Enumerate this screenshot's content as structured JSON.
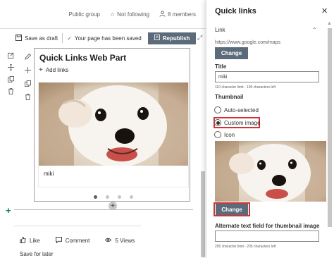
{
  "header": {
    "group_label": "Public group",
    "follow_label": "Not following",
    "members_label": "8 members"
  },
  "cmdbar": {
    "save_draft_label": "Save as draft",
    "saved_status": "Your page has been saved",
    "republish_label": "Republish"
  },
  "webpart": {
    "title": "Quick Links Web Part",
    "add_links_label": "Add links",
    "caption": "miki",
    "carousel_pages": 4,
    "carousel_active": 1
  },
  "social": {
    "like_label": "Like",
    "comment_label": "Comment",
    "views_label": "5 Views",
    "save_later_label": "Save for later"
  },
  "pane": {
    "title": "Quick links",
    "link_section_label": "Link",
    "link_url": "https://www.google.com/maps",
    "change_label": "Change",
    "title_label": "Title",
    "title_value": "miki",
    "title_hint": "110 character limit - 106 characters left",
    "thumbnail_label": "Thumbnail",
    "thumbnail_options": [
      "Auto-selected",
      "Custom image",
      "Icon"
    ],
    "thumbnail_selected": "Custom image",
    "thumbnail_change_label": "Change",
    "alt_label": "Alternate text field for thumbnail image",
    "alt_value": "",
    "alt_hint": "205 character limit - 205 characters left"
  },
  "colors": {
    "primary_button": "#5c6b7a",
    "highlight_border": "#d13438",
    "add_section_plus": "#0b7a57"
  }
}
